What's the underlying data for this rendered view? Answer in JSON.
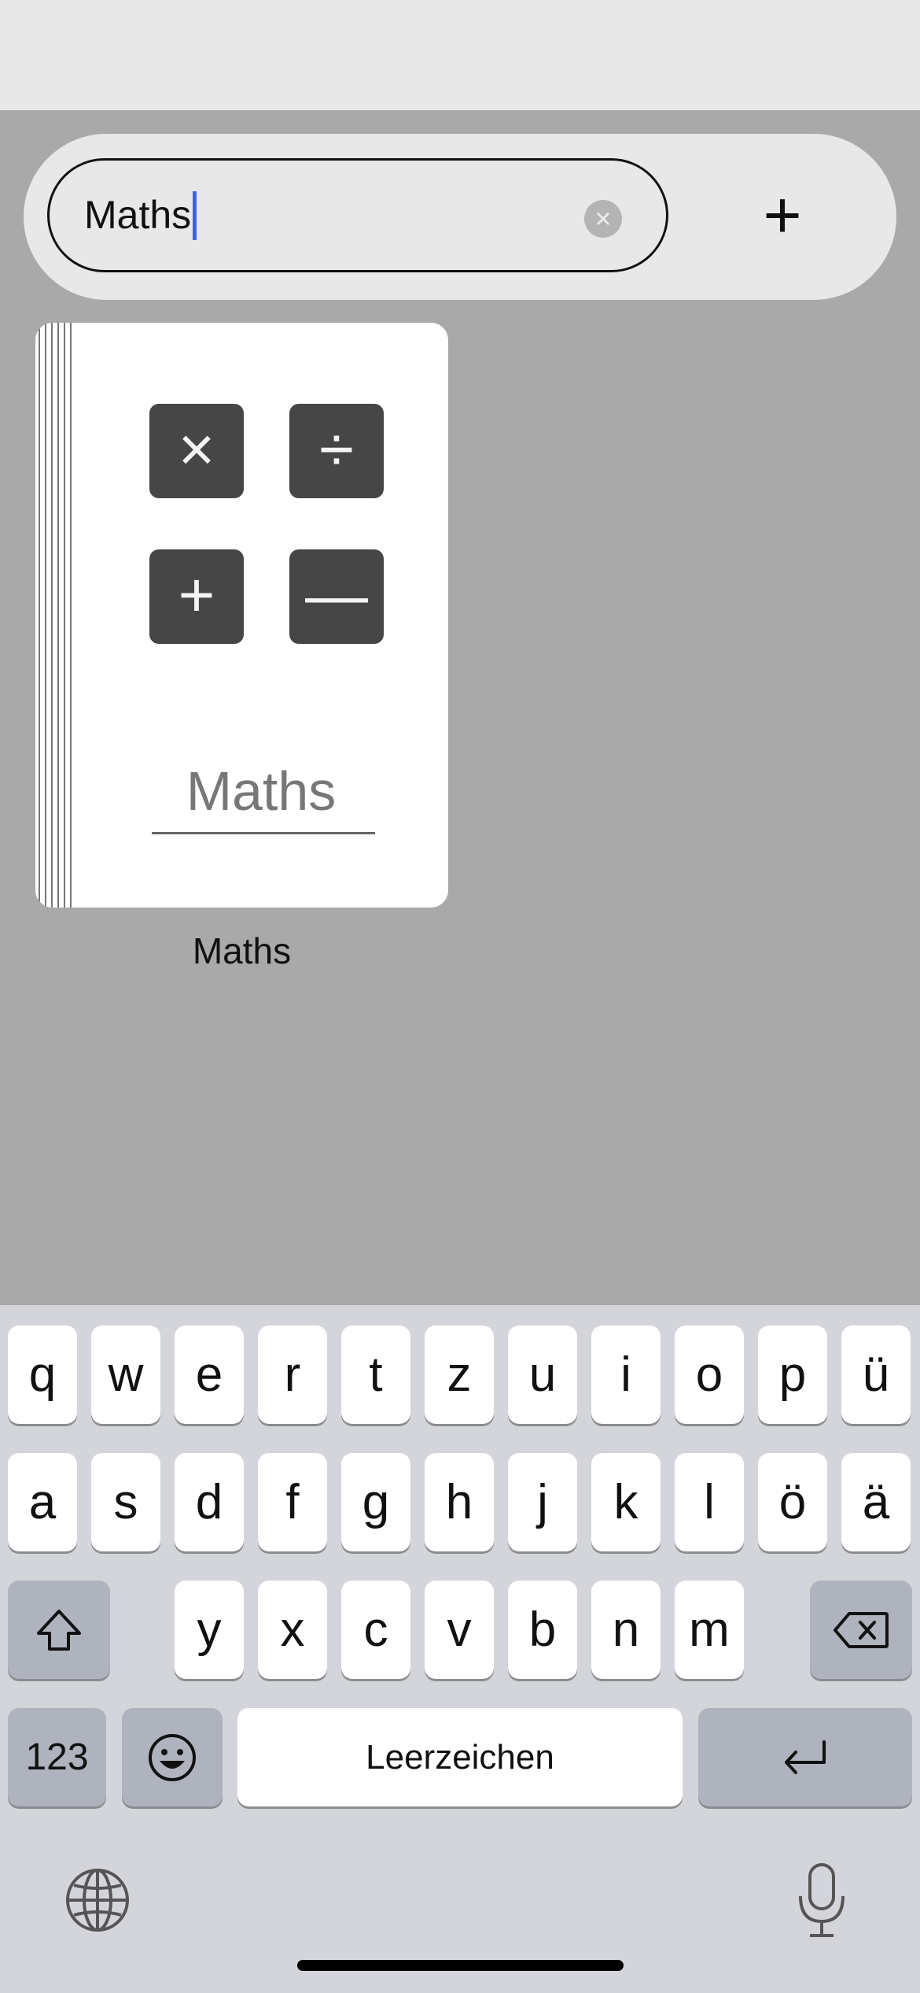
{
  "search": {
    "value": "Maths",
    "clear_icon": "×",
    "add_icon": "+"
  },
  "notebook": {
    "operator_icons": [
      "×",
      "÷",
      "+",
      "—"
    ],
    "cover_title": "Maths",
    "caption": "Maths"
  },
  "keyboard": {
    "row1": [
      "q",
      "w",
      "e",
      "r",
      "t",
      "z",
      "u",
      "i",
      "o",
      "p",
      "ü"
    ],
    "row2": [
      "a",
      "s",
      "d",
      "f",
      "g",
      "h",
      "j",
      "k",
      "l",
      "ö",
      "ä"
    ],
    "row3": [
      "y",
      "x",
      "c",
      "v",
      "b",
      "n",
      "m"
    ],
    "numbers_label": "123",
    "space_label": "Leerzeichen",
    "icons": [
      "shift-icon",
      "backspace-icon",
      "emoji-icon",
      "return-icon",
      "globe-icon",
      "microphone-icon"
    ]
  },
  "colors": {
    "caret": "#3f63e6",
    "background": "#a9a9a9",
    "key_dark": "#aeb3bd",
    "operator_tile": "#464646"
  }
}
